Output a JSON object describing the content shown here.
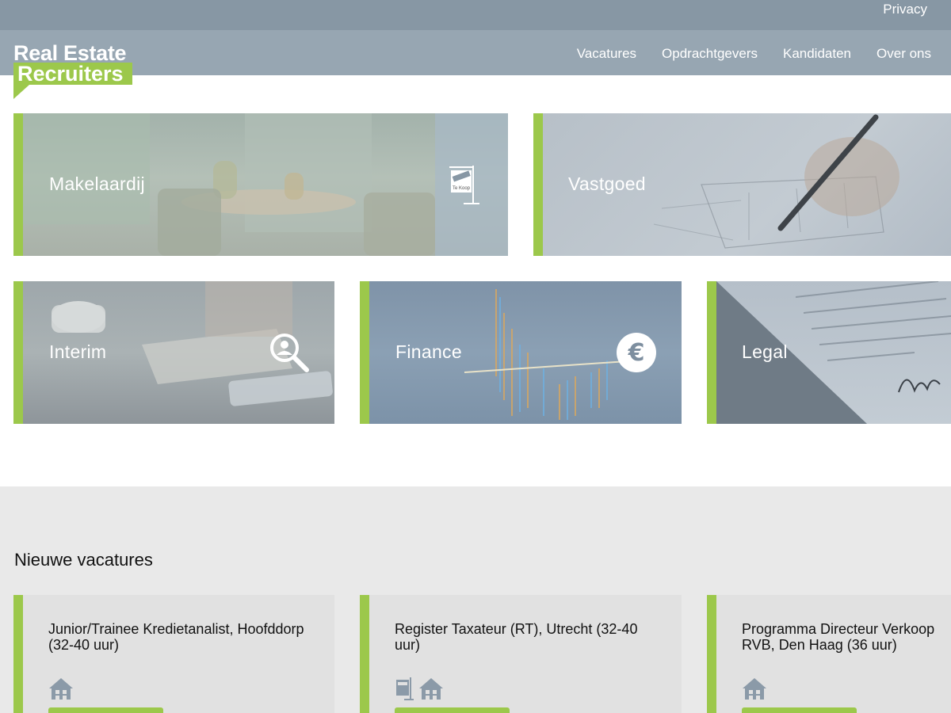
{
  "topbar": {
    "privacy": "Privacy"
  },
  "logo": {
    "line1": "Real Estate",
    "line2": "Recruiters"
  },
  "nav": [
    "Vacatures",
    "Opdrachtgevers",
    "Kandidaten",
    "Over ons"
  ],
  "categories": {
    "makelaardij": {
      "label": "Makelaardij",
      "sign_text": "Te Koop",
      "icon": "for-sale-sign-icon"
    },
    "vastgoed": {
      "label": "Vastgoed"
    },
    "interim": {
      "label": "Interim",
      "icon": "search-person-icon"
    },
    "finance": {
      "label": "Finance",
      "icon": "euro-icon"
    },
    "legal": {
      "label": "Legal"
    }
  },
  "vacatures": {
    "title": "Nieuwe vacatures",
    "items": [
      {
        "title": "Junior/Trainee Kredietanalist, Hoofddorp (32-40 uur)",
        "icons": [
          "building-icon"
        ]
      },
      {
        "title": "Register Taxateur (RT), Utrecht (32-40 uur)",
        "icons": [
          "for-sale-sign-icon",
          "building-icon"
        ]
      },
      {
        "title": "Programma Directeur Verkoop RVB, Den Haag (36 uur)",
        "icons": [
          "building-icon"
        ]
      }
    ]
  },
  "colors": {
    "accent": "#9cc84b",
    "topbar": "#8797a4",
    "navbar": "#97a6b2"
  }
}
